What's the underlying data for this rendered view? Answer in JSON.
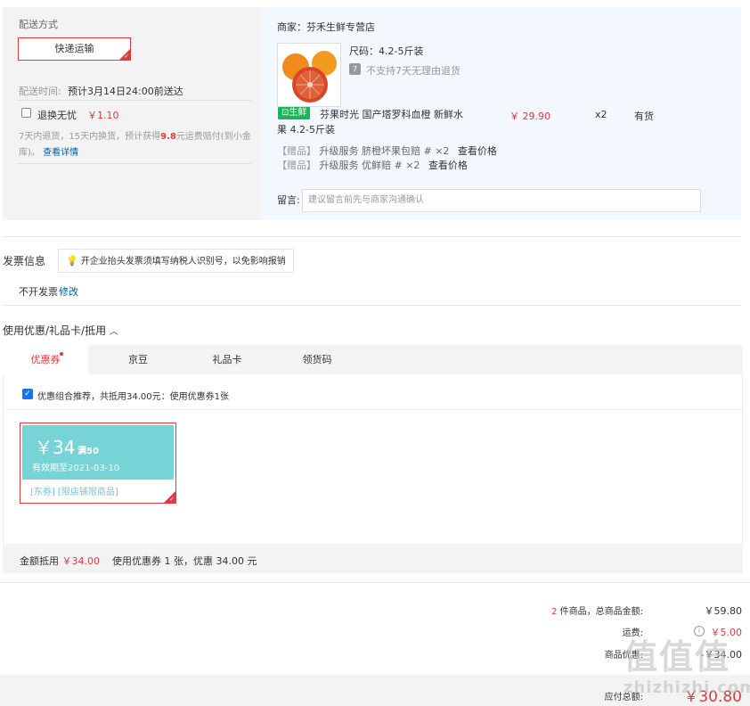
{
  "shipping": {
    "title": "配送方式",
    "method_button": "快递运输",
    "time_label": "配送时间:",
    "time_value": "预计3月14日24:00前送达",
    "worry_free_label": "退换无忧",
    "worry_free_price": "￥1.10",
    "return_text_1": "7天内退货，15天内换货，预计获得",
    "return_highlight": "9.8",
    "return_text_2": "元运费赔付(到小金库)。",
    "return_link": "查看详情"
  },
  "product": {
    "merchant": "商家：芬禾生鲜专营店",
    "spec": "尺码：4.2-5斤装",
    "no_return": "不支持7天无理由退货",
    "badge": "生鲜",
    "name": "芬果时光 国产塔罗科血橙 新鲜水果 4.2-5斤装",
    "price": "￥ 29.90",
    "qty": "x2",
    "stock": "有货",
    "gifts": [
      {
        "tag": "【赠品】",
        "text": "升级服务 脐橙坏果包赔 # ×2",
        "view": "查看价格"
      },
      {
        "tag": "【赠品】",
        "text": "升级服务 优鲜赔 # ×2",
        "view": "查看价格"
      }
    ],
    "note_label": "留言:",
    "note_placeholder": "建议留言前先与商家沟通确认"
  },
  "invoice": {
    "title": "发票信息",
    "tip": "开企业抬头发票须填写纳税人识别号，以免影响报销",
    "status": "不开发票",
    "edit": "修改"
  },
  "coupons": {
    "title": "使用优惠/礼品卡/抵用",
    "tabs": [
      "优惠券",
      "京豆",
      "礼品卡",
      "领货码"
    ],
    "combo_text": "优惠组合推荐，共抵用34.00元：使用优惠券1张",
    "coupon": {
      "amount": "￥34",
      "condition": "满50",
      "expiry": "有效期至2021-03-10",
      "tags": "[东券] [限店铺限商品]"
    },
    "summary_label": "金额抵用",
    "summary_amount": "￥34.00",
    "summary_text": "使用优惠券 1 张，优惠 34.00 元"
  },
  "totals": {
    "count": "2",
    "count_label": "件商品，总商品金额:",
    "goods_total": "￥59.80",
    "freight_label": "运费:",
    "freight": "￥5.00",
    "discount_label": "商品优惠:",
    "discount": "-￥34.00",
    "payable_label": "应付总额:",
    "payable": "￥30.80"
  },
  "watermark": "值值值",
  "watermark_url": "zhizhizhi.com",
  "colors": {
    "accent_red": "#e4393c",
    "link_blue": "#005ea7",
    "coupon_teal": "#76d4d6",
    "fresh_green": "#1fb25a"
  }
}
